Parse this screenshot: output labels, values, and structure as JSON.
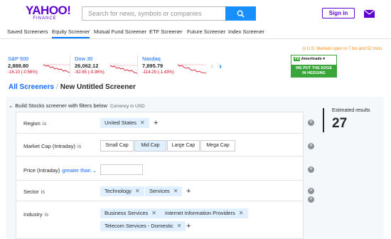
{
  "header": {
    "logo_main": "YAHOO!",
    "logo_sub": "FINANCE",
    "search_placeholder": "Search for news, symbols or companies",
    "signin_label": "Sign in"
  },
  "subnav": {
    "items": [
      "Saved Screeners",
      "Equity Screener",
      "Mutual Fund Screener",
      "ETF Screener",
      "Future Screener",
      "Index Screener"
    ],
    "active": "Equity Screener"
  },
  "market_note": "U.S. Markets open in 7 hrs and 52 mins",
  "tickers": [
    {
      "name": "S&P 500",
      "value": "2,888.80",
      "change": "-16.10 (-0.56%)"
    },
    {
      "name": "Dow 30",
      "value": "26,062.12",
      "change": "-92.65 (-0.36%)"
    },
    {
      "name": "Nasdaq",
      "value": "7,895.79",
      "change": "-114.25 (-1.43%)"
    }
  ],
  "ad": {
    "brand_badge": "TD",
    "brand": "Ameritrade",
    "line1": "WE PUT THE EDGE",
    "line2": "IN HEDGING"
  },
  "breadcrumb": {
    "root": "All Screeners",
    "separator": "/",
    "current": "New Untitled Screener"
  },
  "panel": {
    "title": "Build Stocks screener with filters below",
    "currency": "Currency in USD"
  },
  "filters": {
    "region": {
      "label": "Region",
      "op": "is",
      "chips": [
        "United States"
      ]
    },
    "market_cap": {
      "label": "Market Cap (Intraday)",
      "op": "is",
      "options": [
        "Small Cap",
        "Mid Cap",
        "Large Cap",
        "Mega Cap"
      ],
      "selected": "Mid Cap"
    },
    "price": {
      "label": "Price (Intraday)",
      "op": "greater than",
      "value": ""
    },
    "sector": {
      "label": "Sector",
      "op": "is",
      "chips": [
        "Technology",
        "Services"
      ]
    },
    "industry": {
      "label": "Industry",
      "op": "is",
      "chips": [
        "Business Services",
        "Internet Information Providers",
        "Telecom Services - Domestic"
      ]
    }
  },
  "estimated": {
    "label": "Estimated results",
    "count": "27"
  },
  "colors": {
    "brand_purple": "#5f01d1",
    "accent_blue": "#188fff",
    "link_blue": "#0f69ff",
    "negative_red": "#d0021b",
    "chip_bg": "#e0f0ff",
    "market_orange": "#ff8b12"
  }
}
